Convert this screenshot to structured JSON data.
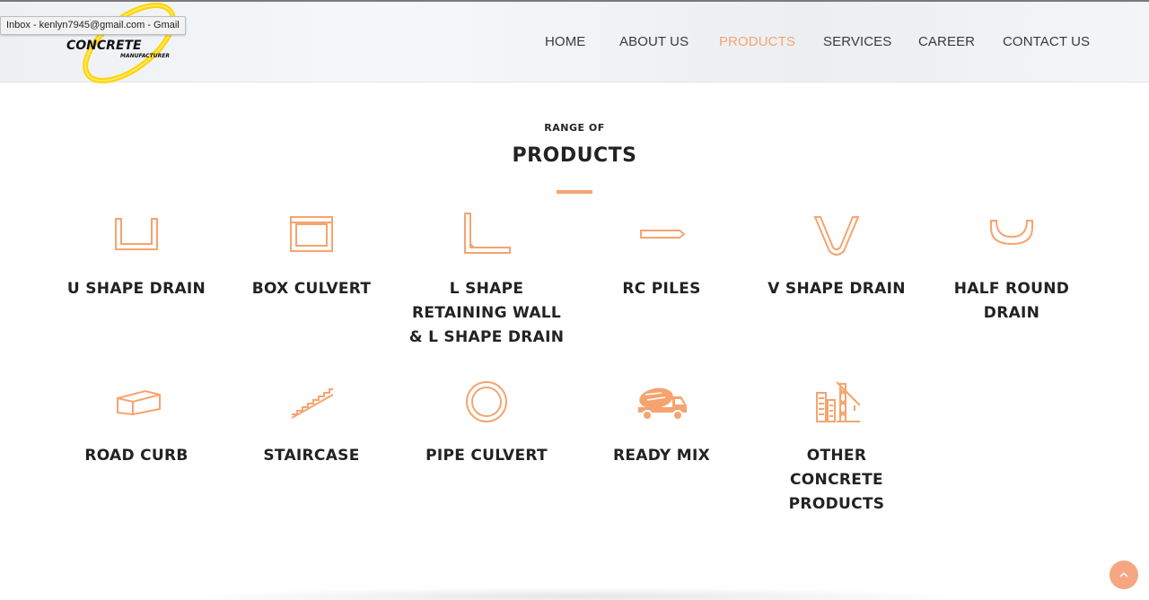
{
  "browser": {
    "tooltip": "Inbox - kenlyn7945@gmail.com - Gmail"
  },
  "brand": {
    "logo_name": "concrete-manufacturer-logo",
    "logo_text": "CONCRETE",
    "logo_subtext": "MANUFACTURER",
    "accent_color": "#f6a46f"
  },
  "nav": {
    "items": [
      {
        "label": "HOME",
        "active": false
      },
      {
        "label": "ABOUT US",
        "active": false
      },
      {
        "label": "PRODUCTS",
        "active": true
      },
      {
        "label": "SERVICES",
        "active": false
      },
      {
        "label": "CAREER",
        "active": false
      },
      {
        "label": "CONTACT US",
        "active": false
      }
    ]
  },
  "section": {
    "kicker": "RANGE OF",
    "title": "PRODUCTS"
  },
  "products": [
    {
      "icon": "u-shape-drain-icon",
      "lines": [
        "U SHAPE DRAIN"
      ]
    },
    {
      "icon": "box-culvert-icon",
      "lines": [
        "BOX CULVERT"
      ]
    },
    {
      "icon": "l-shape-wall-icon",
      "lines": [
        "L SHAPE",
        "RETAINING WALL",
        "& L SHAPE DRAIN"
      ]
    },
    {
      "icon": "rc-piles-icon",
      "lines": [
        "RC PILES"
      ]
    },
    {
      "icon": "v-shape-drain-icon",
      "lines": [
        "V SHAPE DRAIN"
      ]
    },
    {
      "icon": "half-round-drain-icon",
      "lines": [
        "HALF ROUND",
        "DRAIN"
      ]
    },
    {
      "icon": "road-curb-icon",
      "lines": [
        "ROAD CURB"
      ]
    },
    {
      "icon": "staircase-icon",
      "lines": [
        "STAIRCASE"
      ]
    },
    {
      "icon": "pipe-culvert-icon",
      "lines": [
        "PIPE CULVERT"
      ]
    },
    {
      "icon": "mixer-truck-icon",
      "lines": [
        "READY MIX"
      ]
    },
    {
      "icon": "construction-crane-icon",
      "lines": [
        "OTHER",
        "CONCRETE",
        "PRODUCTS"
      ]
    }
  ],
  "scroll_top": {
    "icon": "chevron-up-icon"
  }
}
